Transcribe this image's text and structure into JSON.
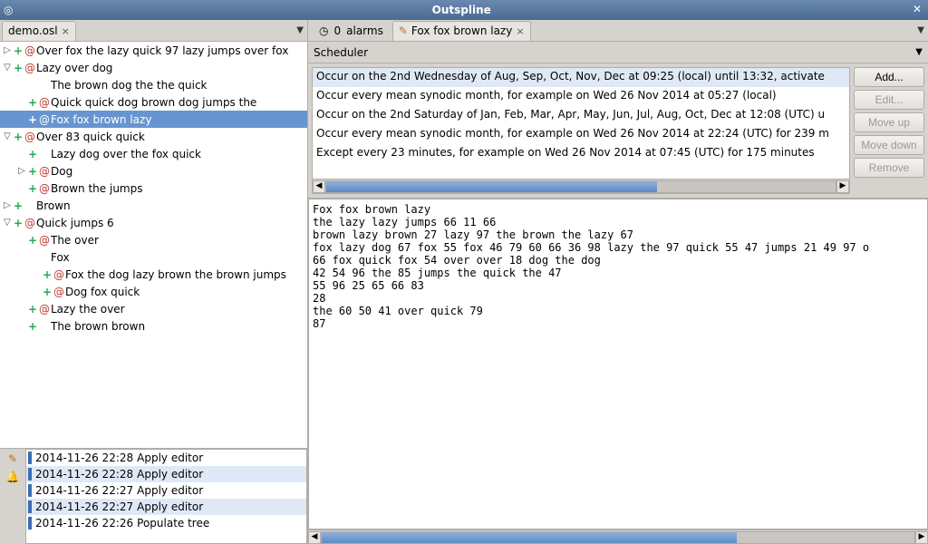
{
  "window": {
    "title": "Outspline"
  },
  "left_tab": {
    "label": "demo.osl"
  },
  "tree": [
    {
      "depth": 0,
      "toggle": "▷",
      "plus": true,
      "at": true,
      "label": "Over fox the lazy quick 97 lazy jumps over fox"
    },
    {
      "depth": 0,
      "toggle": "▽",
      "plus": true,
      "at": true,
      "label": "Lazy over dog"
    },
    {
      "depth": 1,
      "toggle": "",
      "plus": false,
      "at": false,
      "label": "The brown dog the the quick"
    },
    {
      "depth": 1,
      "toggle": "",
      "plus": true,
      "at": true,
      "label": "Quick quick dog brown dog jumps the"
    },
    {
      "depth": 1,
      "toggle": "",
      "plus": true,
      "at": true,
      "label": "Fox fox brown lazy",
      "selected": true
    },
    {
      "depth": 0,
      "toggle": "▽",
      "plus": true,
      "at": true,
      "label": "Over 83 quick quick"
    },
    {
      "depth": 1,
      "toggle": "",
      "plus": true,
      "at": false,
      "label": "Lazy dog over the fox quick"
    },
    {
      "depth": 1,
      "toggle": "▷",
      "plus": true,
      "at": true,
      "label": "Dog"
    },
    {
      "depth": 1,
      "toggle": "",
      "plus": true,
      "at": true,
      "label": "Brown the jumps"
    },
    {
      "depth": 0,
      "toggle": "▷",
      "plus": true,
      "at": false,
      "label": "Brown"
    },
    {
      "depth": 0,
      "toggle": "▽",
      "plus": true,
      "at": true,
      "label": "Quick jumps 6"
    },
    {
      "depth": 1,
      "toggle": "",
      "plus": true,
      "at": true,
      "label": "The over"
    },
    {
      "depth": 1,
      "toggle": "",
      "plus": false,
      "at": false,
      "label": "Fox"
    },
    {
      "depth": 2,
      "toggle": "",
      "plus": true,
      "at": true,
      "label": "Fox the dog lazy brown the brown jumps"
    },
    {
      "depth": 2,
      "toggle": "",
      "plus": true,
      "at": true,
      "label": "Dog fox quick"
    },
    {
      "depth": 1,
      "toggle": "",
      "plus": true,
      "at": true,
      "label": "Lazy the over"
    },
    {
      "depth": 1,
      "toggle": "",
      "plus": true,
      "at": false,
      "label": "The brown brown"
    }
  ],
  "history": [
    {
      "time": "2014-11-26 22:28",
      "action": "Apply editor",
      "hl": false
    },
    {
      "time": "2014-11-26 22:28",
      "action": "Apply editor",
      "hl": true
    },
    {
      "time": "2014-11-26 22:27",
      "action": "Apply editor",
      "hl": false
    },
    {
      "time": "2014-11-26 22:27",
      "action": "Apply editor",
      "hl": true
    },
    {
      "time": "2014-11-26 22:26",
      "action": "Populate tree",
      "hl": false
    }
  ],
  "alarms": {
    "count": "0",
    "label": "alarms"
  },
  "right_tab": {
    "label": "Fox fox brown lazy"
  },
  "scheduler": {
    "header": "Scheduler"
  },
  "rules": [
    "Occur on the 2nd Wednesday of Aug, Sep, Oct, Nov, Dec at 09:25 (local) until 13:32, activate",
    "Occur every mean synodic month, for example on Wed 26 Nov 2014 at 05:27 (local)",
    "Occur on the 2nd Saturday of Jan, Feb, Mar, Apr, May, Jun, Jul, Aug, Oct, Dec at 12:08 (UTC) u",
    "Occur every mean synodic month, for example on Wed 26 Nov 2014 at 22:24 (UTC) for 239 m",
    "Except every 23 minutes, for example on Wed 26 Nov 2014 at 07:45 (UTC) for 175 minutes"
  ],
  "buttons": {
    "add": "Add...",
    "edit": "Edit...",
    "move_up": "Move up",
    "move_down": "Move down",
    "remove": "Remove"
  },
  "body_text": "Fox fox brown lazy\nthe lazy lazy jumps 66 11 66\nbrown lazy brown 27 lazy 97 the brown the lazy 67\nfox lazy dog 67 fox 55 fox 46 79 60 66 36 98 lazy the 97 quick 55 47 jumps 21 49 97 o\n66 fox quick fox 54 over over 18 dog the dog\n42 54 96 the 85 jumps the quick the 47\n55 96 25 65 66 83\n28\nthe 60 50 41 over quick 79\n87"
}
